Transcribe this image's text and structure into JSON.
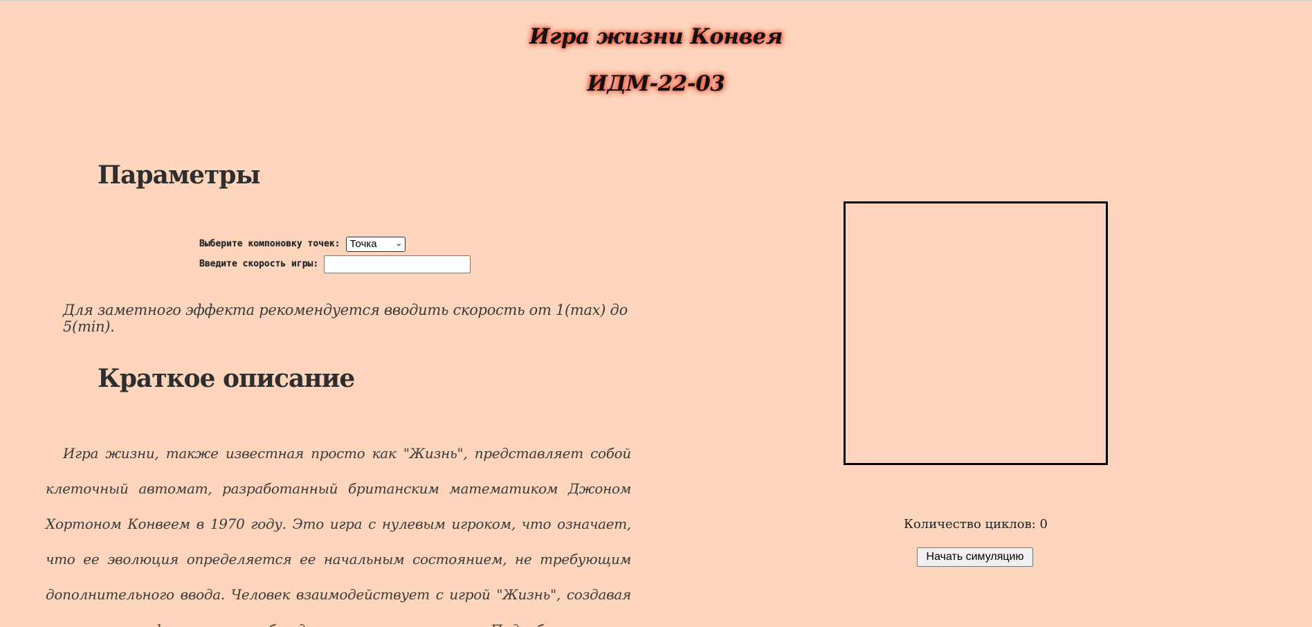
{
  "header": {
    "title": "Игра жизни Конвея",
    "group": "ИДМ-22-03"
  },
  "params": {
    "title": "Параметры",
    "layout_label": "Выберите компоновку точек:",
    "layout_selected": "Точка",
    "speed_label": "Введите скорость игры:",
    "speed_value": "",
    "hint": "Для заметного эффекта рекомендуется вводить скорость от 1(max) до 5(min)."
  },
  "about": {
    "title": "Краткое описание",
    "text": "Игра жизни, также известная просто как \"Жизнь\", представляет собой клеточный автомат, разработанный британским математиком Джоном Хортоном Конвеем в 1970 году. Это игра с нулевым игроком, что означает, что ее эволюция определяется ее начальным состоянием, не требующим дополнительного ввода. Человек взаимодействует с игрой \"Жизнь\", создавая начальную конфигурацию и наблюдая, как она развивается. Подробнее"
  },
  "simulation": {
    "cycles_label": "Количество циклов: 0",
    "start_button": "Начать симуляцию"
  }
}
